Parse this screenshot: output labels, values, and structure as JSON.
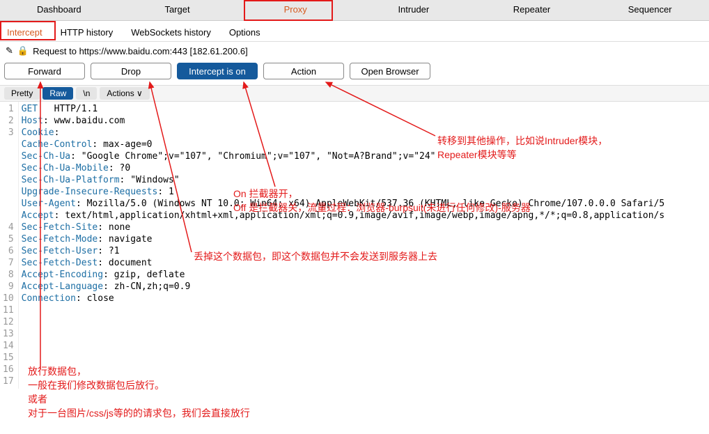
{
  "topTabs": {
    "dashboard": "Dashboard",
    "target": "Target",
    "proxy": "Proxy",
    "intruder": "Intruder",
    "repeater": "Repeater",
    "sequencer": "Sequencer"
  },
  "subTabs": {
    "intercept": "Intercept",
    "httpHistory": "HTTP history",
    "wsHistory": "WebSockets history",
    "options": "Options"
  },
  "requestLabel": "Request to https://www.baidu.com:443  [182.61.200.6]",
  "buttons": {
    "forward": "Forward",
    "drop": "Drop",
    "intercept": "Intercept is on",
    "action": "Action",
    "openBrowser": "Open Browser"
  },
  "editorTabs": {
    "pretty": "Pretty",
    "raw": "Raw",
    "newline": "\\n",
    "actions": "Actions ∨"
  },
  "code": [
    {
      "n": 1,
      "pre": "",
      "k": "GET",
      "mid": "   ",
      "a": "HTTP/1.1"
    },
    {
      "n": 2,
      "pre": "",
      "k": "Host",
      "mid": ": ",
      "a": "www.baidu.com"
    },
    {
      "n": 3,
      "pre": "",
      "k": "Cookie",
      "mid": ":",
      "a": ""
    },
    {
      "n": "",
      "pre": "",
      "k": "Cache-Control",
      "mid": ": ",
      "a": "max-age=0"
    },
    {
      "n": "",
      "pre": "",
      "k": "Sec-Ch-Ua",
      "mid": ": ",
      "a": "\"Google Chrome\";v=\"107\", \"Chromium\";v=\"107\", \"Not=A?Brand\";v=\"24\""
    },
    {
      "n": "",
      "pre": "",
      "k": "Sec-Ch-Ua-Mobile",
      "mid": ": ",
      "a": "?0"
    },
    {
      "n": "",
      "pre": "",
      "k": "Sec-Ch-Ua-Platform",
      "mid": ": ",
      "a": "\"Windows\""
    },
    {
      "n": "",
      "pre": "",
      "k": "Upgrade-Insecure-Requests",
      "mid": ": ",
      "a": "1"
    },
    {
      "n": "",
      "pre": "",
      "k": "User-Agent",
      "mid": ": ",
      "a": "Mozilla/5.0 (Windows NT 10.0; Win64; x64) AppleWebKit/537.36 (KHTML, like Gecko) Chrome/107.0.0.0 Safari/5"
    },
    {
      "n": "",
      "pre": "",
      "k": "Accept",
      "mid": ": ",
      "a": "text/html,application/xhtml+xml,application/xml;q=0.9,image/avif,image/webp,image/apng,*/*;q=0.8,application/s"
    },
    {
      "n": 4,
      "pre": "",
      "k": "Sec-Fetch-Site",
      "mid": ": ",
      "a": "none"
    },
    {
      "n": 5,
      "pre": "",
      "k": "Sec-Fetch-Mode",
      "mid": ": ",
      "a": "navigate"
    },
    {
      "n": 6,
      "pre": "",
      "k": "Sec-Fetch-User",
      "mid": ": ",
      "a": "?1"
    },
    {
      "n": 7,
      "pre": "",
      "k": "Sec-Fetch-Dest",
      "mid": ": ",
      "a": "document"
    },
    {
      "n": 8,
      "pre": "",
      "k": "Accept-Encoding",
      "mid": ": ",
      "a": "gzip, deflate"
    },
    {
      "n": 9,
      "pre": "",
      "k": "Accept-Language",
      "mid": ": ",
      "a": "zh-CN,zh;q=0.9"
    },
    {
      "n": 10,
      "pre": "",
      "k": "Connection",
      "mid": ": ",
      "a": "close"
    },
    {
      "n": 11,
      "pre": "",
      "k": "",
      "mid": "",
      "a": ""
    },
    {
      "n": 12,
      "pre": "",
      "k": "",
      "mid": "",
      "a": ""
    },
    {
      "n": 13,
      "pre": "",
      "k": "",
      "mid": "",
      "a": ""
    },
    {
      "n": 14,
      "pre": "",
      "k": "",
      "mid": "",
      "a": ""
    },
    {
      "n": 15,
      "pre": "",
      "k": "",
      "mid": "",
      "a": ""
    },
    {
      "n": 16,
      "pre": "",
      "k": "",
      "mid": "",
      "a": ""
    },
    {
      "n": 17,
      "pre": "",
      "k": "",
      "mid": "",
      "a": ""
    }
  ],
  "annotations": {
    "intercept": "On 拦截器开，\nOff 是拦截器关，流量过程：浏览器-burpsuit(未进行任何修改)-服务器",
    "action": "转移到其他操作，比如说Intruder模块，\nRepeater模块等等",
    "drop": "丢掉这个数据包，即这个数据包并不会发送到服务器上去",
    "forward": "放行数据包，\n一般在我们修改数据包后放行。\n或者\n对于一台图片/css/js等的的请求包，我们会直接放行"
  }
}
